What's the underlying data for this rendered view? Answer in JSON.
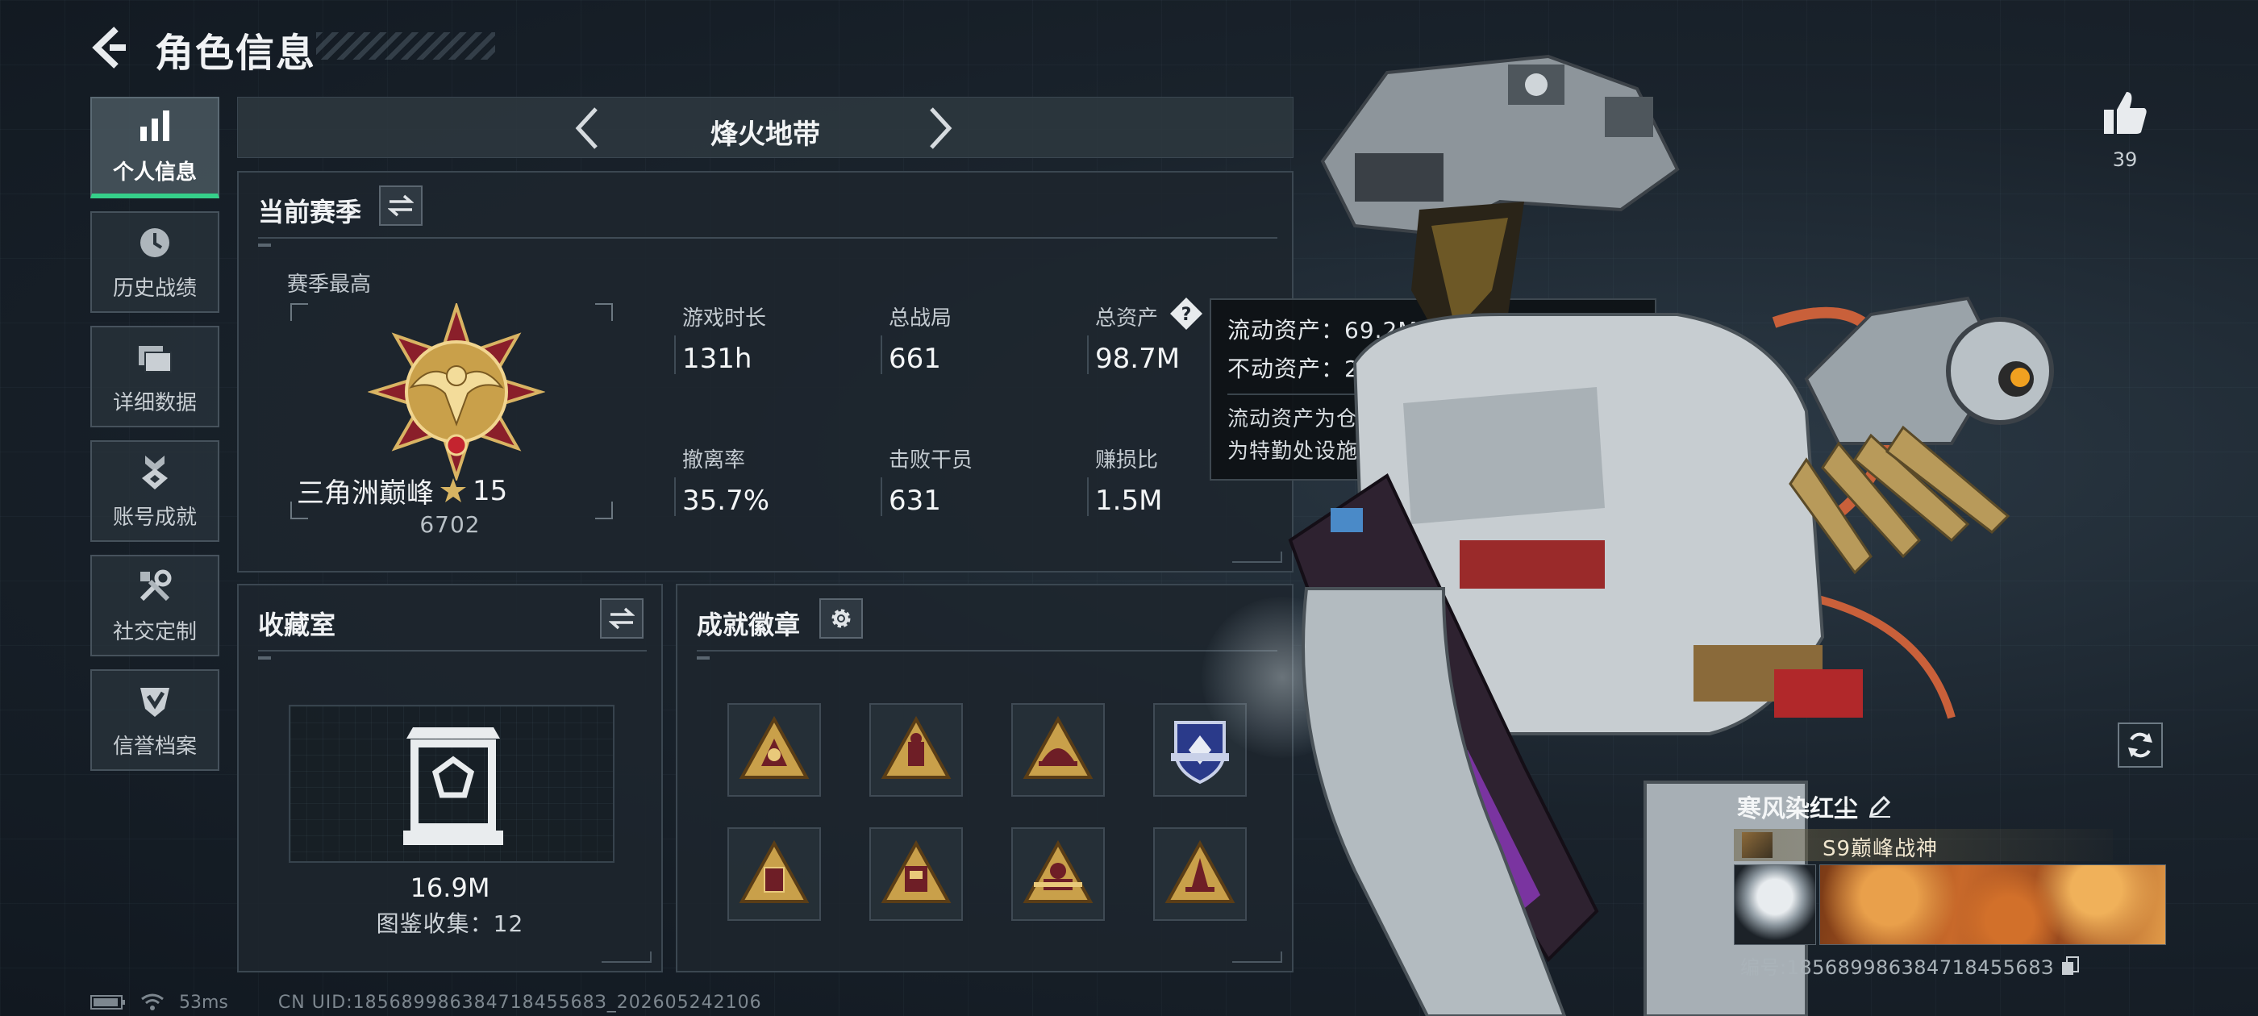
{
  "header": {
    "title": "角色信息"
  },
  "nav": {
    "items": [
      {
        "label": "个人信息",
        "icon": "bar-chart-icon",
        "active": true
      },
      {
        "label": "历史战绩",
        "icon": "clock-icon",
        "active": false
      },
      {
        "label": "详细数据",
        "icon": "folder-icon",
        "active": false
      },
      {
        "label": "账号成就",
        "icon": "medal-icon",
        "active": false
      },
      {
        "label": "社交定制",
        "icon": "tools-icon",
        "active": false
      },
      {
        "label": "信誉档案",
        "icon": "shield-check-icon",
        "active": false
      }
    ]
  },
  "mode": {
    "title": "烽火地带"
  },
  "season": {
    "title": "当前赛季",
    "best_label": "赛季最高",
    "rank_name": "三角洲巅峰",
    "rank_stars": "15",
    "rank_points": "6702",
    "stats": [
      {
        "label": "游戏时长",
        "value": "131h"
      },
      {
        "label": "总战局",
        "value": "661"
      },
      {
        "label": "总资产",
        "value": "98.7M"
      },
      {
        "label": "撤离率",
        "value": "35.7%"
      },
      {
        "label": "击败干员",
        "value": "631"
      },
      {
        "label": "赚损比",
        "value": "1.5M"
      }
    ]
  },
  "tooltip": {
    "line1": "流动资产：69.2M",
    "line2": "不动资产：29.5M",
    "desc_line1": "流动资产为仓库资产和哈夫币，不动资产",
    "desc_line2": "为特勤处设施和收藏室设施"
  },
  "collection": {
    "title": "收藏室",
    "value": "16.9M",
    "count_label": "图鉴收集：12"
  },
  "badges": {
    "title": "成就徽章",
    "items": [
      "badge-triangle-1",
      "badge-triangle-2",
      "badge-triangle-3",
      "badge-shield-blue",
      "badge-triangle-4",
      "badge-triangle-5",
      "badge-triangle-6",
      "badge-triangle-7"
    ]
  },
  "status": {
    "ping": "53ms",
    "uid": "CN UID:18568998638471845568З_202605242106"
  },
  "like": {
    "count": "39"
  },
  "player": {
    "name": "寒风染红尘",
    "title": "S9巅峰战神",
    "id": "编号:18568998638471845568З"
  },
  "colors": {
    "accent_green": "#35d08a",
    "gold": "#c9a04a",
    "panel_bg": "#1e262e"
  }
}
